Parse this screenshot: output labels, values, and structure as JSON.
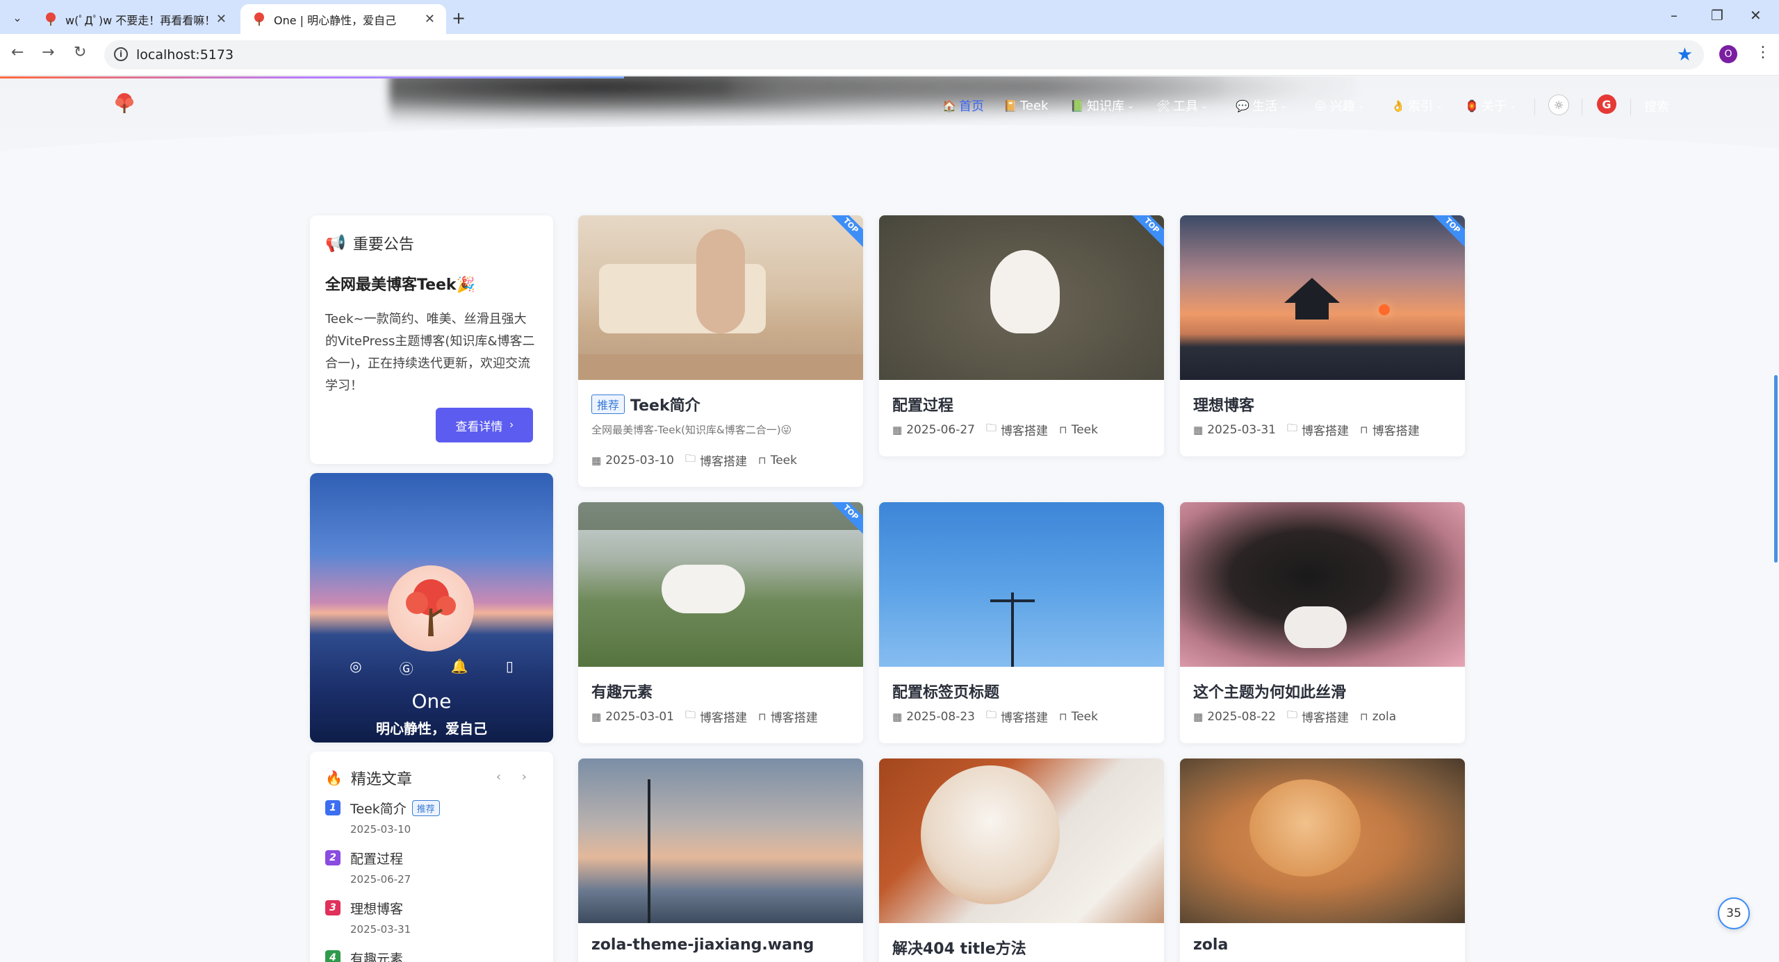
{
  "browser": {
    "tabs": [
      {
        "title": "w(ﾟДﾟ)w 不要走！再看看嘛！",
        "active": false
      },
      {
        "title": "One | 明心静性，爱自己",
        "active": true
      }
    ],
    "url": "localhost:5173",
    "profile_initial": "O",
    "window_controls": {
      "minimize": "–",
      "restore": "❐",
      "close": "✕"
    }
  },
  "nav": {
    "items": [
      {
        "label": "首页",
        "icon": "home-icon",
        "has_menu": false
      },
      {
        "label": "Teek",
        "icon": "book-icon",
        "has_menu": false
      },
      {
        "label": "知识库",
        "icon": "library-icon",
        "has_menu": true
      },
      {
        "label": "工具",
        "icon": "tools-icon",
        "has_menu": true
      },
      {
        "label": "生活",
        "icon": "chat-icon",
        "has_menu": true
      },
      {
        "label": "兴趣",
        "icon": "face-icon",
        "has_menu": true
      },
      {
        "label": "索引",
        "icon": "hand-icon",
        "has_menu": true
      },
      {
        "label": "关于",
        "icon": "lamp-icon",
        "has_menu": true
      }
    ],
    "search_label": "搜索"
  },
  "notice": {
    "heading": "重要公告",
    "title": "全网最美博客Teek🎉",
    "body": "Teek~一款简约、唯美、丝滑且强大的VitePress主题博客(知识库&博客二合一)，正在持续迭代更新，欢迎交流学习！",
    "button": "查看详情"
  },
  "profile": {
    "name": "One",
    "motto": "明心静性，爱自己",
    "socials": [
      "github-icon",
      "gitee-icon",
      "qq-icon",
      "phone-icon"
    ]
  },
  "featured": {
    "heading": "精选文章",
    "items": [
      {
        "rank": "1",
        "title": "Teek简介",
        "tag": "推荐",
        "date": "2025-03-10",
        "color": "#3c6ef0"
      },
      {
        "rank": "2",
        "title": "配置过程",
        "tag": "",
        "date": "2025-06-27",
        "color": "#8a4be0"
      },
      {
        "rank": "3",
        "title": "理想博客",
        "tag": "",
        "date": "2025-03-31",
        "color": "#e0305b"
      },
      {
        "rank": "4",
        "title": "有趣元素",
        "tag": "",
        "date": "",
        "color": "#2f9a4b"
      }
    ]
  },
  "posts": [
    {
      "title": "Teek简介",
      "tag": "推荐",
      "desc": "全网最美博客-Teek(知识库&博客二合一)😜",
      "date": "2025-03-10",
      "category": "博客搭建",
      "label": "Teek",
      "top": "TOP"
    },
    {
      "title": "配置过程",
      "tag": "",
      "desc": "",
      "date": "2025-06-27",
      "category": "博客搭建",
      "label": "Teek",
      "top": "TOP"
    },
    {
      "title": "理想博客",
      "tag": "",
      "desc": "",
      "date": "2025-03-31",
      "category": "博客搭建",
      "label": "博客搭建",
      "top": "TOP"
    },
    {
      "title": "有趣元素",
      "tag": "",
      "desc": "",
      "date": "2025-03-01",
      "category": "博客搭建",
      "label": "博客搭建",
      "top": "TOP"
    },
    {
      "title": "配置标签页标题",
      "tag": "",
      "desc": "",
      "date": "2025-08-23",
      "category": "博客搭建",
      "label": "Teek",
      "top": ""
    },
    {
      "title": "这个主题为何如此丝滑",
      "tag": "",
      "desc": "",
      "date": "2025-08-22",
      "category": "博客搭建",
      "label": "zola",
      "top": ""
    },
    {
      "title": "zola-theme-jiaxiang.wang",
      "tag": "",
      "desc": "",
      "date": "",
      "category": "",
      "label": "",
      "top": ""
    },
    {
      "title": "解决404 title方法",
      "tag": "",
      "desc": "",
      "date": "",
      "category": "",
      "label": "",
      "top": ""
    },
    {
      "title": "zola",
      "tag": "",
      "desc": "",
      "date": "",
      "category": "",
      "label": "",
      "top": ""
    }
  ],
  "float_counter": "35"
}
